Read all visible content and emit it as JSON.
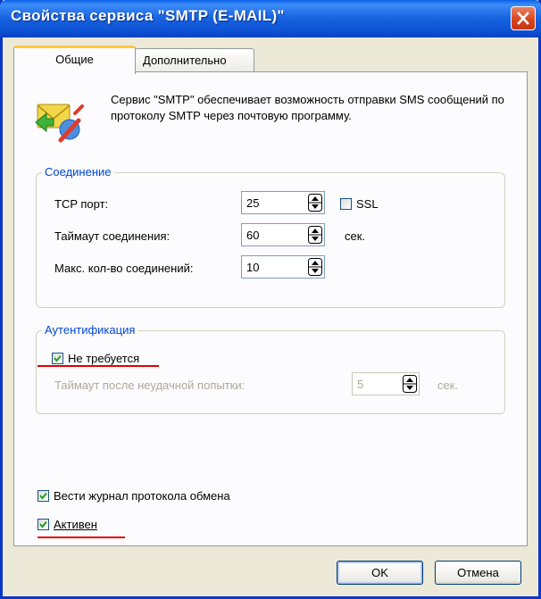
{
  "window": {
    "title": "Свойства сервиса \"SMTP (E-MAIL)\""
  },
  "tabs": [
    {
      "label": "Общие",
      "active": true
    },
    {
      "label": "Дополнительно",
      "active": false
    }
  ],
  "description": "Сервис \"SMTP\" обеспечивает возможность отправки SMS сообщений по протоколу SMTP через почтовую программу.",
  "connection": {
    "title": "Соединение",
    "tcp_port_label": "TCP порт:",
    "tcp_port_value": "25",
    "ssl_label": "SSL",
    "ssl_checked": false,
    "timeout_label": "Таймаут соединения:",
    "timeout_value": "60",
    "timeout_unit": "сек.",
    "max_conn_label": "Макс. кол-во соединений:",
    "max_conn_value": "10"
  },
  "auth": {
    "title": "Аутентификация",
    "not_required_label": "Не требуется",
    "not_required_checked": true,
    "retry_timeout_label": "Таймаут после неудачной попытки:",
    "retry_timeout_value": "5",
    "retry_timeout_unit": "сек."
  },
  "log_exchange_label": "Вести журнал протокола обмена",
  "log_exchange_checked": true,
  "active_label": "Активен",
  "active_checked": true,
  "buttons": {
    "ok": "OK",
    "cancel": "Отмена"
  },
  "colors": {
    "title_bar": "#0a5fe6",
    "group_title": "#0046d5",
    "highlight_underline": "#e00000",
    "close_button": "#d5431d"
  }
}
